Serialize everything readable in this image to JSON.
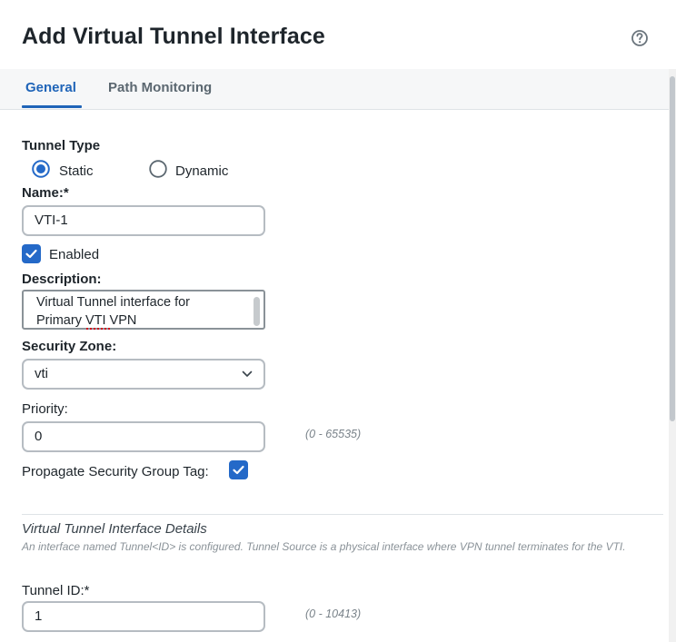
{
  "dialog": {
    "title": "Add Virtual Tunnel Interface"
  },
  "tabs": [
    {
      "label": "General",
      "active": true
    },
    {
      "label": "Path Monitoring",
      "active": false
    }
  ],
  "form": {
    "tunnel_type": {
      "label": "Tunnel Type",
      "options": [
        "Static",
        "Dynamic"
      ],
      "selected": "Static"
    },
    "name": {
      "label": "Name:*",
      "value": "VTI-1"
    },
    "enabled": {
      "label": "Enabled",
      "checked": true
    },
    "description": {
      "label": "Description:",
      "value": "Virtual Tunnel interface for\nPrimary VTI VPN"
    },
    "security_zone": {
      "label": "Security Zone:",
      "value": "vti"
    },
    "priority": {
      "label": "Priority:",
      "value": "0",
      "hint": "(0 - 65535)"
    },
    "propagate_sgt": {
      "label": "Propagate Security Group Tag:",
      "checked": true
    },
    "vti_details": {
      "title": "Virtual Tunnel Interface Details",
      "description": "An interface named Tunnel<ID> is configured. Tunnel Source is a physical interface where VPN tunnel terminates for the VTI."
    },
    "tunnel_id": {
      "label": "Tunnel ID:*",
      "value": "1",
      "hint": "(0 - 10413)"
    }
  },
  "colors": {
    "accent": "#2469c8",
    "tab_active": "#1f64b8",
    "border": "#b6bcc2"
  },
  "icons": {
    "help": "question-circle-icon",
    "select": "chevron-down-icon",
    "check": "checkmark-icon"
  }
}
